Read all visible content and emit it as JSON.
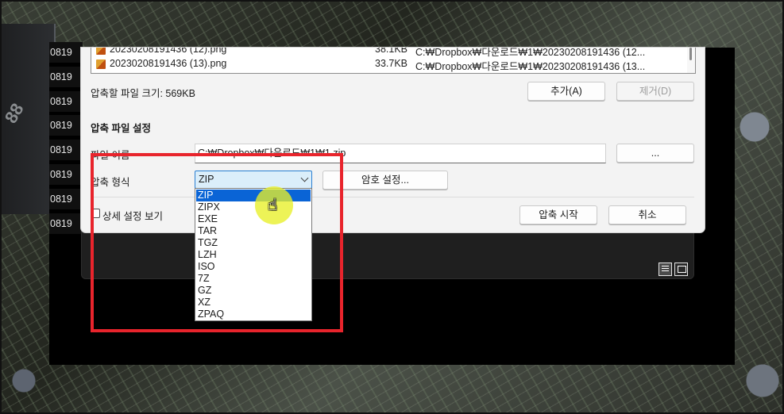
{
  "files": [
    {
      "name": "20230208191436 (12).png",
      "size": "38.1KB",
      "path": "C:₩Dropbox₩다운로드₩1₩20230208191436 (12..."
    },
    {
      "name": "20230208191436 (13).png",
      "size": "33.7KB",
      "path": "C:₩Dropbox₩다운로드₩1₩20230208191436 (13..."
    }
  ],
  "background_rows": [
    "0819",
    "0819",
    "0819",
    "0819",
    "0819",
    "0819",
    "0819",
    "0819"
  ],
  "background_chip_label": "88",
  "dialog": {
    "compress_size_label": "압축할 파일 크기: 569KB",
    "add_button": "추가(A)",
    "remove_button": "제거(D)",
    "section_title": "압축 파일 설정",
    "filename_label": "파일 이름",
    "filename_value": "C:₩Dropbox₩다운로드₩1₩1.zip",
    "browse_button": "...",
    "format_label": "압축 형식",
    "format_selected": "ZIP",
    "password_button": "암호 설정...",
    "advanced_checkbox_label": "상세 설정 보기",
    "start_button": "압축 시작",
    "cancel_button": "취소"
  },
  "format_options": [
    "ZIP",
    "ZIPX",
    "EXE",
    "TAR",
    "TGZ",
    "LZH",
    "ISO",
    "7Z",
    "GZ",
    "XZ",
    "ZPAQ"
  ],
  "highlighted_option": "ZIP",
  "annotation_color": "#e8242c",
  "cursor": "hand-pointer-icon"
}
